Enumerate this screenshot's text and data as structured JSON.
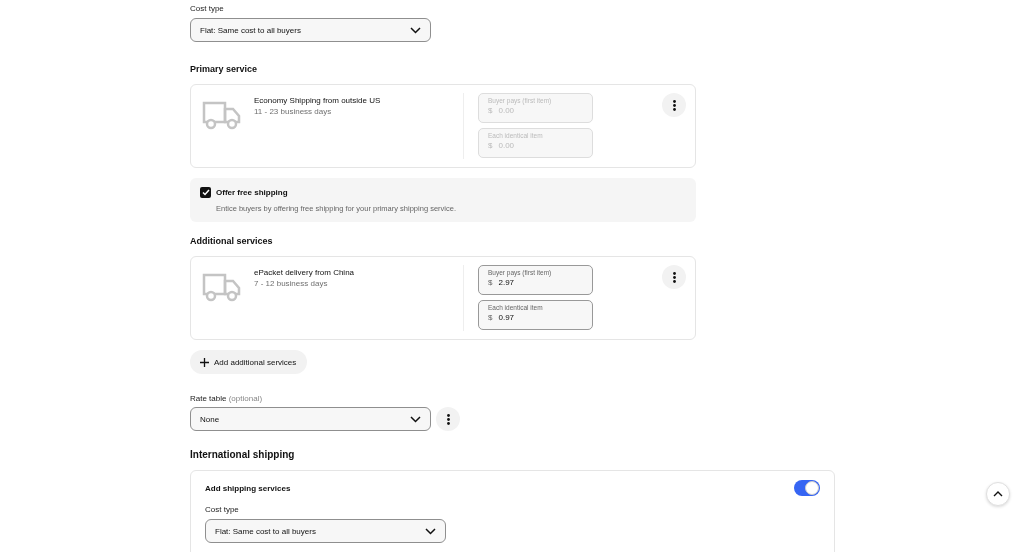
{
  "cost_type": {
    "label": "Cost type",
    "value": "Flat: Same cost to all buyers"
  },
  "primary_service": {
    "heading": "Primary service",
    "services": [
      {
        "name": "Economy Shipping from outside US",
        "duration": "11 - 23 business days",
        "prices": [
          {
            "label": "Buyer pays (first item)",
            "currency": "$",
            "value": "0.00",
            "disabled": true
          },
          {
            "label": "Each identical item",
            "currency": "$",
            "value": "0.00",
            "disabled": true
          }
        ]
      }
    ]
  },
  "free_shipping": {
    "label": "Offer free shipping",
    "description": "Entice buyers by offering free shipping for your primary shipping service.",
    "checked": true
  },
  "additional_services": {
    "heading": "Additional services",
    "services": [
      {
        "name": "ePacket delivery from China",
        "duration": "7 - 12 business days",
        "prices": [
          {
            "label": "Buyer pays (first item)",
            "currency": "$",
            "value": "2.97",
            "disabled": false
          },
          {
            "label": "Each identical item",
            "currency": "$",
            "value": "0.97",
            "disabled": false
          }
        ]
      }
    ],
    "add_button": "Add additional services"
  },
  "rate_table": {
    "label": "Rate table",
    "hint": "(optional)",
    "value": "None"
  },
  "international_shipping": {
    "heading": "International shipping",
    "card_title": "Add shipping services",
    "on": true,
    "cost_type": {
      "label": "Cost type",
      "value": "Flat: Same cost to all buyers"
    }
  }
}
